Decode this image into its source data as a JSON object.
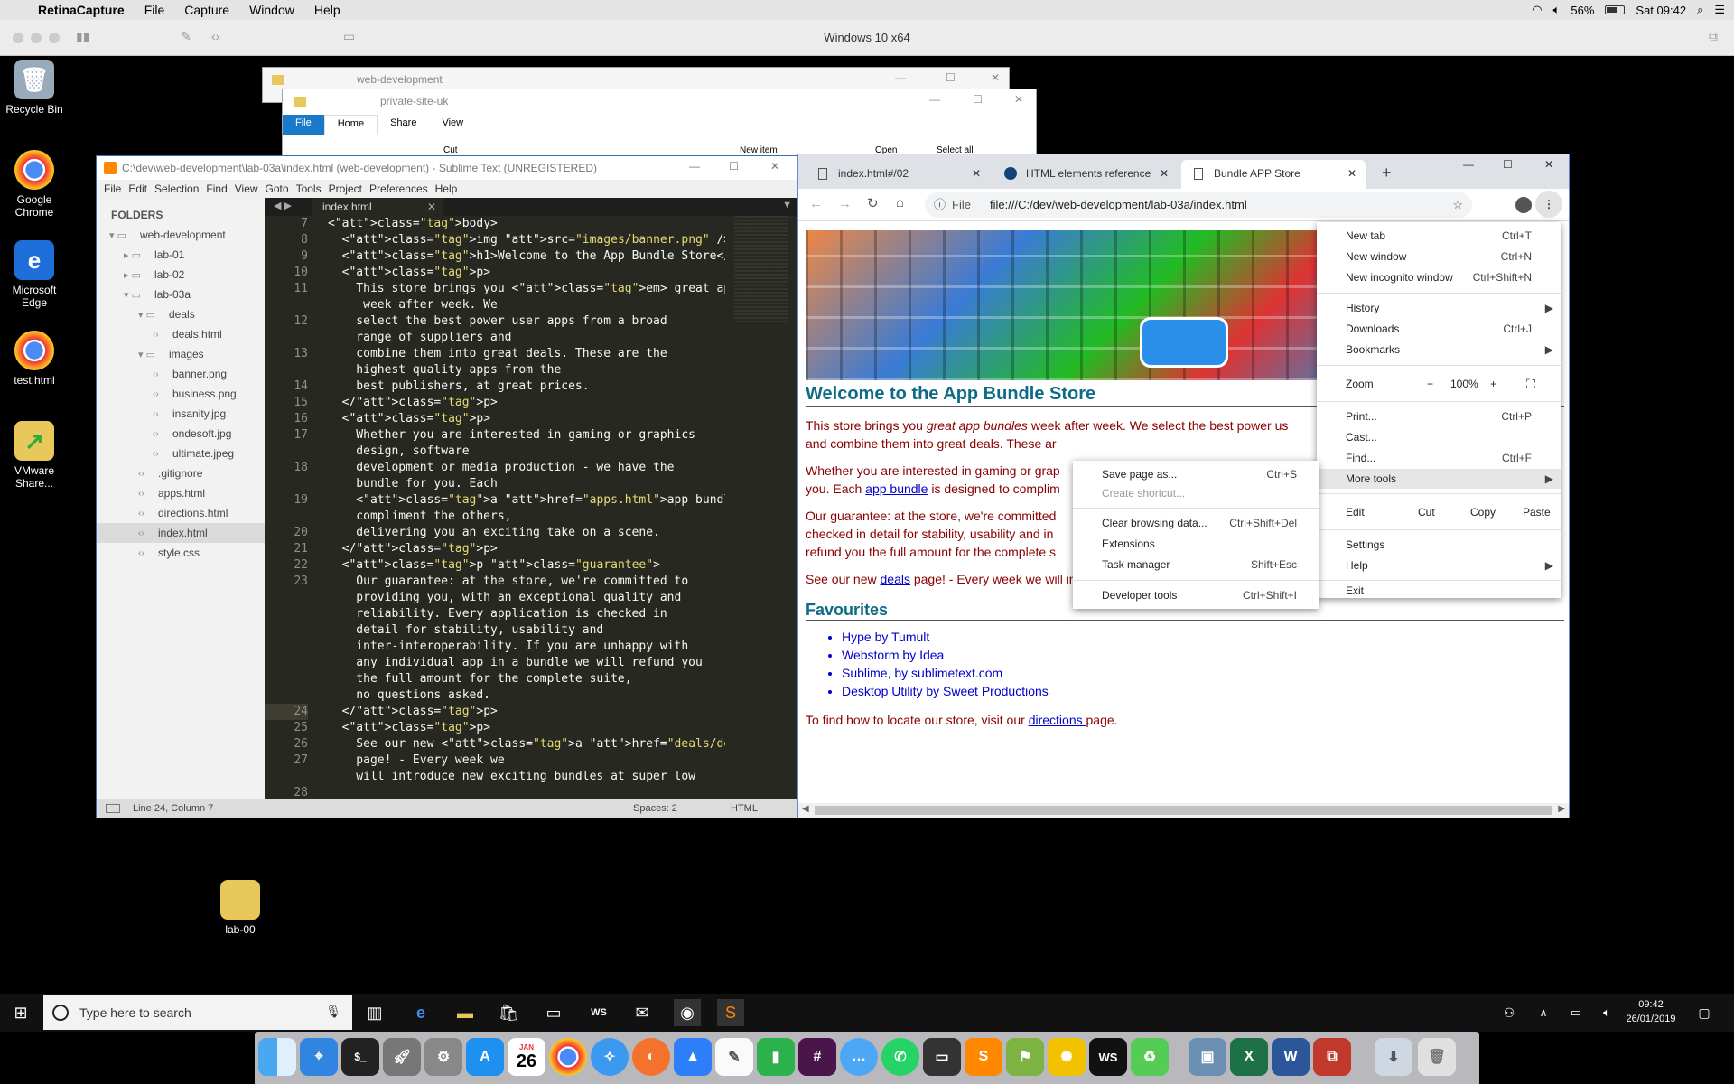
{
  "mac_menubar": {
    "items": [
      "RetinaCapture",
      "File",
      "Capture",
      "Window",
      "Help"
    ],
    "battery": "56%",
    "clock": "Sat 09:42"
  },
  "vm": {
    "title": "Windows 10 x64"
  },
  "desktop_icons": [
    {
      "label": "Recycle Bin"
    },
    {
      "label": "Google Chrome"
    },
    {
      "label": "Microsoft Edge"
    },
    {
      "label": "test.html"
    },
    {
      "label": "VMware Share..."
    },
    {
      "label": "lab-00"
    }
  ],
  "explorer_back": {
    "title": "web-development"
  },
  "explorer_front": {
    "title": "private-site-uk",
    "tabs": [
      "File",
      "Home",
      "Share",
      "View"
    ],
    "ribbon": [
      "Cut",
      "New item",
      "Open",
      "Select all"
    ]
  },
  "sublime": {
    "title": "C:\\dev\\web-development\\lab-03a\\index.html (web-development) - Sublime Text (UNREGISTERED)",
    "menu": [
      "File",
      "Edit",
      "Selection",
      "Find",
      "View",
      "Goto",
      "Tools",
      "Project",
      "Preferences",
      "Help"
    ],
    "folders_label": "FOLDERS",
    "tree": [
      {
        "label": "web-development",
        "indent": 0,
        "kind": "folder-open"
      },
      {
        "label": "lab-01",
        "indent": 1,
        "kind": "folder"
      },
      {
        "label": "lab-02",
        "indent": 1,
        "kind": "folder"
      },
      {
        "label": "lab-03a",
        "indent": 1,
        "kind": "folder-open"
      },
      {
        "label": "deals",
        "indent": 2,
        "kind": "folder-open"
      },
      {
        "label": "deals.html",
        "indent": 3,
        "kind": "file"
      },
      {
        "label": "images",
        "indent": 2,
        "kind": "folder-open"
      },
      {
        "label": "banner.png",
        "indent": 3,
        "kind": "file"
      },
      {
        "label": "business.png",
        "indent": 3,
        "kind": "file"
      },
      {
        "label": "insanity.jpg",
        "indent": 3,
        "kind": "file"
      },
      {
        "label": "ondesoft.jpg",
        "indent": 3,
        "kind": "file"
      },
      {
        "label": "ultimate.jpeg",
        "indent": 3,
        "kind": "file"
      },
      {
        "label": ".gitignore",
        "indent": 2,
        "kind": "file"
      },
      {
        "label": "apps.html",
        "indent": 2,
        "kind": "file"
      },
      {
        "label": "directions.html",
        "indent": 2,
        "kind": "file"
      },
      {
        "label": "index.html",
        "indent": 2,
        "kind": "file",
        "selected": true
      },
      {
        "label": "style.css",
        "indent": 2,
        "kind": "file"
      }
    ],
    "tab": "index.html",
    "gutter": [
      "7",
      "8",
      "9",
      "10",
      "11",
      "",
      "12",
      "",
      "13",
      "",
      "14",
      "15",
      "16",
      "17",
      "",
      "18",
      "",
      "19",
      "",
      "20",
      "21",
      "22",
      "23",
      "",
      "",
      "",
      "",
      "",
      "",
      "",
      "24",
      "25",
      "26",
      "27",
      "",
      "28"
    ],
    "code": [
      "<body>",
      "  <img src=\"images/banner.png\" />",
      "  <h1>Welcome to the App Bundle Store</h1>",
      "  <p>",
      "    This store brings you <em> great app bundles </em>",
      "     week after week. We",
      "    select the best power user apps from a broad",
      "    range of suppliers and",
      "    combine them into great deals. These are the",
      "    highest quality apps from the",
      "    best publishers, at great prices.",
      "  </p>",
      "  <p>",
      "    Whether you are interested in gaming or graphics",
      "    design, software",
      "    development or media production - we have the",
      "    bundle for you. Each",
      "    <a href=\"apps.html\">app bundle</a> is designed to",
      "    compliment the others,",
      "    delivering you an exciting take on a scene.",
      "  </p>",
      "  <p class=\"guarantee\">",
      "    Our guarantee: at the store, we're committed to",
      "    providing you, with an exceptional quality and",
      "    reliability. Every application is checked in",
      "    detail for stability, usability and",
      "    inter-interoperability. If you are unhappy with",
      "    any individual app in a bundle we will refund you",
      "    the full amount for the complete suite,",
      "    no questions asked.",
      "  </p>",
      "  <p>",
      "    See our new <a href=\"deals/deals.html\"> deals</a>",
      "    page! - Every week we",
      "    will introduce new exciting bundles at super low"
    ],
    "status": {
      "position": "Line 24, Column 7",
      "spaces": "Spaces: 2",
      "syntax": "HTML"
    }
  },
  "chrome": {
    "tabs": [
      "index.html#/02",
      "HTML elements reference",
      "Bundle APP Store"
    ],
    "url_scheme": "File",
    "url": "file:///C:/dev/web-development/lab-03a/index.html",
    "page": {
      "h1": "Welcome to the App Bundle Store",
      "p1_a": "This store brings you ",
      "p1_em": "great app bundles",
      "p1_b": " week after week. We select the best power us",
      "p1_c": "and combine them into great deals. These ar",
      "p2_a": "Whether you are interested in gaming or grap",
      "p2_b": "you. Each ",
      "p2_link": "app bundle",
      "p2_c": " is designed to complim",
      "p3_a": "Our guarantee: at the store, we're committed",
      "p3_b": "checked in detail for stability, usability and in",
      "p3_c": "refund you the full amount for the complete s",
      "p4_a": "See our new ",
      "p4_link": "deals",
      "p4_b": " page! - Every week we will introduce new exciting bundles at super low prices!",
      "h2": "Favourites",
      "favourites": [
        "Hype by Tumult",
        "Webstorm by Idea",
        "Sublime, by sublimetext.com",
        "Desktop Utility by Sweet Productions"
      ],
      "p5_a": "To find how to locate our store, visit our ",
      "p5_link": "directions ",
      "p5_b": "page."
    },
    "menu": {
      "new_tab": "New tab",
      "new_tab_sc": "Ctrl+T",
      "new_window": "New window",
      "new_window_sc": "Ctrl+N",
      "incognito": "New incognito window",
      "incognito_sc": "Ctrl+Shift+N",
      "history": "History",
      "downloads": "Downloads",
      "downloads_sc": "Ctrl+J",
      "bookmarks": "Bookmarks",
      "zoom": "Zoom",
      "zoom_minus": "−",
      "zoom_value": "100%",
      "zoom_plus": "+",
      "print": "Print...",
      "print_sc": "Ctrl+P",
      "cast": "Cast...",
      "find": "Find...",
      "find_sc": "Ctrl+F",
      "more_tools": "More tools",
      "edit": "Edit",
      "cut": "Cut",
      "copy": "Copy",
      "paste": "Paste",
      "settings": "Settings",
      "help": "Help",
      "exit": "Exit"
    },
    "submenu": {
      "save": "Save page as...",
      "save_sc": "Ctrl+S",
      "shortcut": "Create shortcut...",
      "clear": "Clear browsing data...",
      "clear_sc": "Ctrl+Shift+Del",
      "extensions": "Extensions",
      "task": "Task manager",
      "task_sc": "Shift+Esc",
      "devtools": "Developer tools",
      "devtools_sc": "Ctrl+Shift+I"
    }
  },
  "taskbar": {
    "search_placeholder": "Type here to search",
    "time": "09:42",
    "date": "26/01/2019"
  },
  "dock": {
    "calendar_month": "JAN",
    "calendar_day": "26"
  }
}
